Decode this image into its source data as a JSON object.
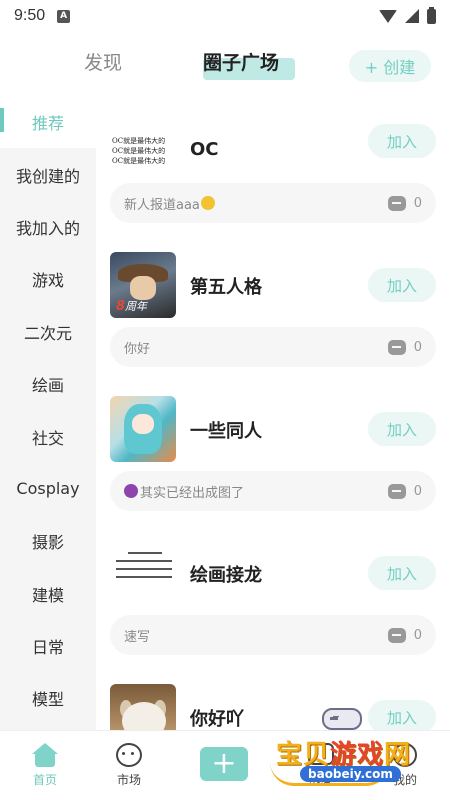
{
  "status_bar": {
    "time": "9:50",
    "notification_badge": "A"
  },
  "header": {
    "tabs": [
      {
        "label": "发现"
      },
      {
        "label": "圈子广场"
      }
    ],
    "create_label": "+ 创建",
    "accent_color": "#6fc9bd"
  },
  "sidebar": {
    "items": [
      {
        "label": "推荐",
        "active": true
      },
      {
        "label": "我创建的"
      },
      {
        "label": "我加入的"
      },
      {
        "label": "游戏"
      },
      {
        "label": "二次元"
      },
      {
        "label": "绘画"
      },
      {
        "label": "社交"
      },
      {
        "label": "Cosplay"
      },
      {
        "label": "摄影"
      },
      {
        "label": "建模"
      },
      {
        "label": "日常"
      },
      {
        "label": "模型"
      }
    ]
  },
  "circles": [
    {
      "name": "OC",
      "join_label": "加入",
      "latest_post": "新人报道aaa",
      "comment_count": "0",
      "thumb_lines": [
        "OC就是最伟大的",
        "OC就是最伟大的",
        "OC就是最伟大的"
      ]
    },
    {
      "name": "第五人格",
      "join_label": "加入",
      "latest_post": "你好",
      "comment_count": "0",
      "thumb_text": "周年",
      "thumb_number": "8"
    },
    {
      "name": "一些同人",
      "join_label": "加入",
      "latest_post": "其实已经出成图了",
      "comment_count": "0"
    },
    {
      "name": "绘画接龙",
      "join_label": "加入",
      "latest_post": "速写",
      "comment_count": "0"
    },
    {
      "name": "你好吖",
      "join_label": "加入"
    }
  ],
  "bottom_nav": {
    "items": [
      {
        "label": "首页",
        "icon": "home-icon",
        "active": true
      },
      {
        "label": "市场",
        "icon": "planet-icon"
      },
      {
        "label": "消息",
        "icon": "message-icon"
      },
      {
        "label": "我的",
        "icon": "profile-icon"
      }
    ]
  },
  "watermark": {
    "text_main": "宝贝",
    "text_accent": "游戏",
    "text_end": "网",
    "url": "baobeiy.com"
  }
}
